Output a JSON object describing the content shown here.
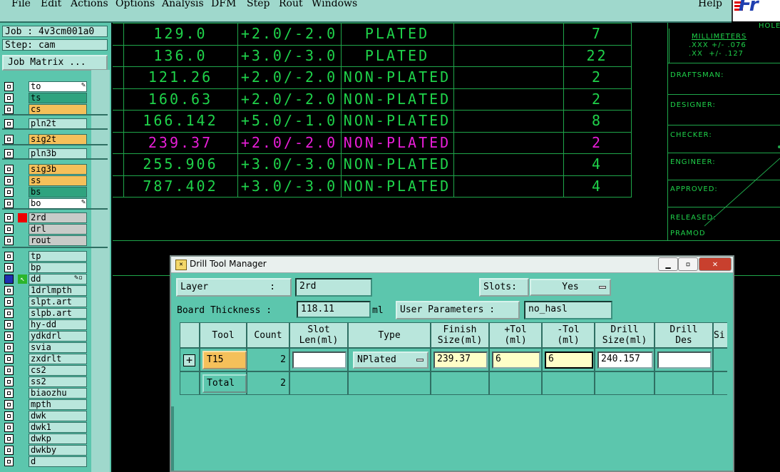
{
  "menu": {
    "file": "File",
    "edit": "Edit",
    "actions": "Actions",
    "options": "Options",
    "analysis": "Analysis",
    "dfm": "DFM",
    "step": "Step",
    "rout": "Rout",
    "windows": "Windows",
    "help": "Help"
  },
  "logo": {
    "text": "Fr"
  },
  "job": {
    "job_line": "Job : 4v3cm001a0",
    "step_line": "Step: cam",
    "matrix_button": "Job Matrix ..."
  },
  "layers": [
    {
      "name": "to",
      "color": "#ffffff"
    },
    {
      "name": "ts",
      "color": "#2fa37f"
    },
    {
      "name": "cs",
      "color": "#f5c05a"
    },
    {
      "name": "pln2t",
      "color": "#b9e6dc"
    },
    {
      "name": "sig2t",
      "color": "#f5c05a"
    },
    {
      "name": "pln3b",
      "color": "#b9e6dc"
    },
    {
      "name": "sig3b",
      "color": "#f5c05a"
    },
    {
      "name": "ss",
      "color": "#f5c05a"
    },
    {
      "name": "bs",
      "color": "#2fa37f"
    },
    {
      "name": "bo",
      "color": "#ffffff"
    },
    {
      "name": "2rd",
      "color": "#c8cbc8"
    },
    {
      "name": "drl",
      "color": "#c8cbc8"
    },
    {
      "name": "rout",
      "color": "#c8cbc8"
    },
    {
      "name": "tp",
      "color": "#b9e6dc"
    },
    {
      "name": "bp",
      "color": "#b9e6dc"
    },
    {
      "name": "dd",
      "color": "#b9e6dc"
    },
    {
      "name": "1drlmpth",
      "color": "#b9e6dc"
    },
    {
      "name": "slpt.art",
      "color": "#b9e6dc"
    },
    {
      "name": "slpb.art",
      "color": "#b9e6dc"
    },
    {
      "name": "hy-dd",
      "color": "#b9e6dc"
    },
    {
      "name": "ydkdrl",
      "color": "#b9e6dc"
    },
    {
      "name": "svia",
      "color": "#b9e6dc"
    },
    {
      "name": "zxdrlt",
      "color": "#b9e6dc"
    },
    {
      "name": "cs2",
      "color": "#b9e6dc"
    },
    {
      "name": "ss2",
      "color": "#b9e6dc"
    },
    {
      "name": "biaozhu",
      "color": "#b9e6dc"
    },
    {
      "name": "mpth",
      "color": "#b9e6dc"
    },
    {
      "name": "dwk",
      "color": "#b9e6dc"
    },
    {
      "name": "dwk1",
      "color": "#b9e6dc"
    },
    {
      "name": "dwkp",
      "color": "#b9e6dc"
    },
    {
      "name": "dwkby",
      "color": "#b9e6dc"
    },
    {
      "name": "d",
      "color": "#b9e6dc"
    }
  ],
  "drill_table": [
    {
      "size": "129.0",
      "tol": "+2.0/-2.0",
      "type": "PLATED",
      "qty": "7",
      "color": "#1fd24a"
    },
    {
      "size": "136.0",
      "tol": "+3.0/-3.0",
      "type": "PLATED",
      "qty": "22",
      "color": "#1fd24a"
    },
    {
      "size": "121.26",
      "tol": "+2.0/-2.0",
      "type": "NON-PLATED",
      "qty": "2",
      "color": "#1fd24a"
    },
    {
      "size": "160.63",
      "tol": "+2.0/-2.0",
      "type": "NON-PLATED",
      "qty": "2",
      "color": "#1fd24a"
    },
    {
      "size": "166.142",
      "tol": "+5.0/-1.0",
      "type": "NON-PLATED",
      "qty": "8",
      "color": "#1fd24a"
    },
    {
      "size": "239.37",
      "tol": "+2.0/-2.0",
      "type": "NON-PLATED",
      "qty": "2",
      "color": "#e81ed8"
    },
    {
      "size": "255.906",
      "tol": "+3.0/-3.0",
      "type": "NON-PLATED",
      "qty": "4",
      "color": "#1fd24a"
    },
    {
      "size": "787.402",
      "tol": "+3.0/-3.0",
      "type": "NON-PLATED",
      "qty": "4",
      "color": "#1fd24a"
    }
  ],
  "title_block": {
    "hole": "HOLE",
    "units": "MILLIMETERS",
    "tol1": ".XXX +/- .076",
    "tol2": ".XX  +/- .127",
    "draftsman": "DRAFTSMAN:",
    "designer": "DESIGNER:",
    "checker": "CHECKER:",
    "engineer": "ENGINEER:",
    "approved": "APPROVED:",
    "released": "RELEASED:",
    "released_by": "PRAMOD"
  },
  "dialog": {
    "title": "Drill Tool Manager",
    "layer_label": "Layer           :",
    "layer_value": "2rd",
    "slots_label": "Slots:",
    "slots_value": "Yes",
    "thickness_label": "Board Thickness :",
    "thickness_value": "118.11",
    "thickness_unit": "ml",
    "user_params_label": "User Parameters :",
    "user_params_value": "no_hasl",
    "columns": [
      "Tool",
      "Count",
      "Slot\nLen(ml)",
      "Type",
      "Finish\nSize(ml)",
      "+Tol\n(ml)",
      "-Tol\n(ml)",
      "Drill\nSize(ml)",
      "Drill\nDes",
      "Si"
    ],
    "row": {
      "tool": "T15",
      "count": "2",
      "slot_len": "",
      "type": "NPlated",
      "finish": "239.37",
      "plus_tol": "6",
      "minus_tol": "6",
      "drill_size": "240.157",
      "drill_des": ""
    },
    "total_row": {
      "label": "Total",
      "count": "2"
    }
  }
}
